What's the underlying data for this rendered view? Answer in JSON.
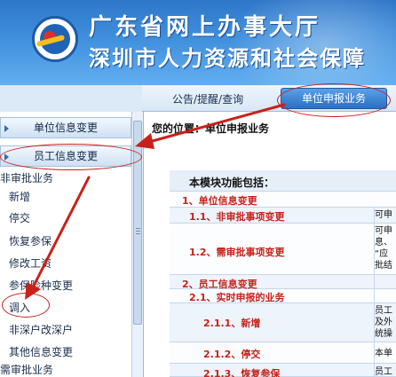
{
  "header": {
    "title_line1": "广东省网上办事大厅",
    "title_line2": "深圳市人力资源和社会保障"
  },
  "nav": {
    "link": "公告/提醒/查询",
    "active_tab": "单位申报业务"
  },
  "sidebar": {
    "section_unit": "单位信息变更",
    "section_employee": "员工信息变更",
    "group_no_approval": "非审批业务",
    "items": [
      "新增",
      "停交",
      "恢复参保",
      "修改工资",
      "参保险种变更",
      "调入",
      "非深户改深户",
      "其他信息变更"
    ],
    "group_approval": "需审批业务"
  },
  "main": {
    "breadcrumb": "您的位置：单位申报业务",
    "func_title": "本模块功能包括：",
    "rows": [
      {
        "label": "1、单位信息变更",
        "side": ""
      },
      {
        "label": "1.1、非审批事项变更",
        "side": "可申"
      },
      {
        "label": "1.2、需审批事项变更",
        "side": "可申\n息、\n“应\n批结"
      },
      {
        "label": "2、员工信息变更",
        "side": ""
      },
      {
        "label": "2.1、实时申报的业务",
        "side": ""
      },
      {
        "label": "2.1.1、新增",
        "side": "员工\n及外\n统操"
      },
      {
        "label": "2.1.2、停交",
        "side": "本单"
      },
      {
        "label": "2.1.3、恢复参保",
        "side": "员工"
      }
    ]
  },
  "colors": {
    "header_blue": "#3f8fdd",
    "annotation_red": "#c8211a",
    "heading_red": "#c8211a"
  }
}
